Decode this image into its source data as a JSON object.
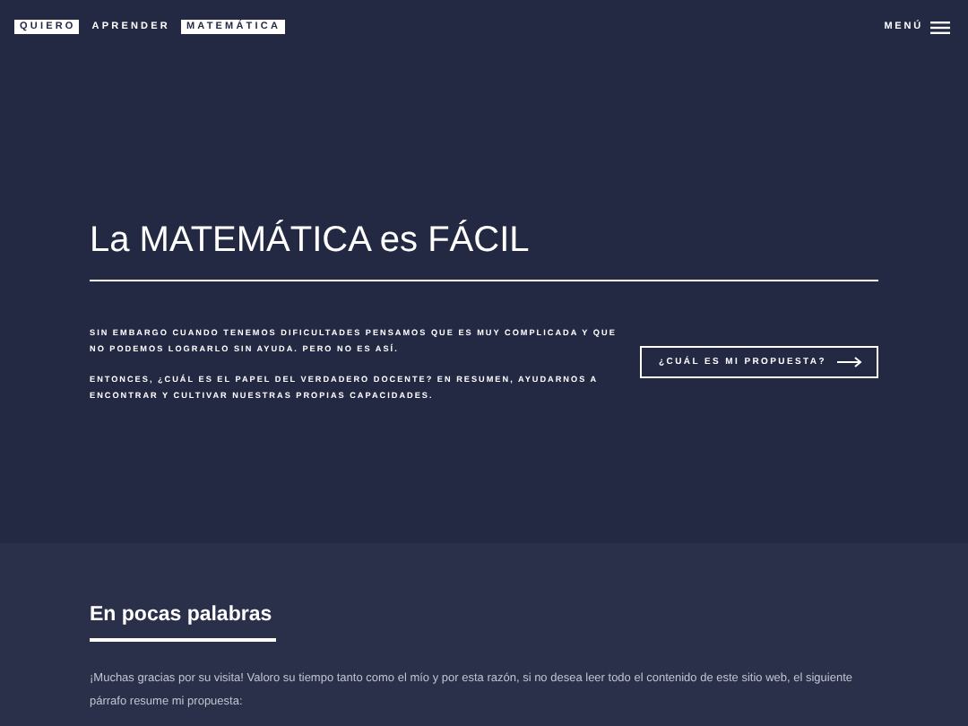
{
  "header": {
    "logo": [
      {
        "text": "QUIERO",
        "boxed": true
      },
      {
        "text": "APRENDER",
        "boxed": false
      },
      {
        "text": "MATEMÁTICA",
        "boxed": true
      }
    ],
    "menu": "MENÚ"
  },
  "hero": {
    "title": "La MATEMÁTICA es FÁCIL",
    "paragraphs": [
      "SIN EMBARGO CUANDO TENEMOS DIFICULTADES PENSAMOS QUE ES MUY COMPLICADA Y QUE NO PODEMOS LOGRARLO SIN AYUDA. PERO NO ES ASÍ.",
      "ENTONCES, ¿CUÁL ES EL PAPEL DEL VERDADERO DOCENTE? EN RESUMEN, AYUDARNOS A ENCONTRAR Y CULTIVAR NUESTRAS PROPIAS CAPACIDADES."
    ],
    "button": "¿CUÁL ES MI PROPUESTA?"
  },
  "section": {
    "heading": "En pocas palabras",
    "text": "¡Muchas gracias por su visita! Valoro su tiempo tanto como el mío y por esta razón, si no desea leer todo el contenido de este sitio web, el siguiente párrafo resume mi propuesta:"
  }
}
